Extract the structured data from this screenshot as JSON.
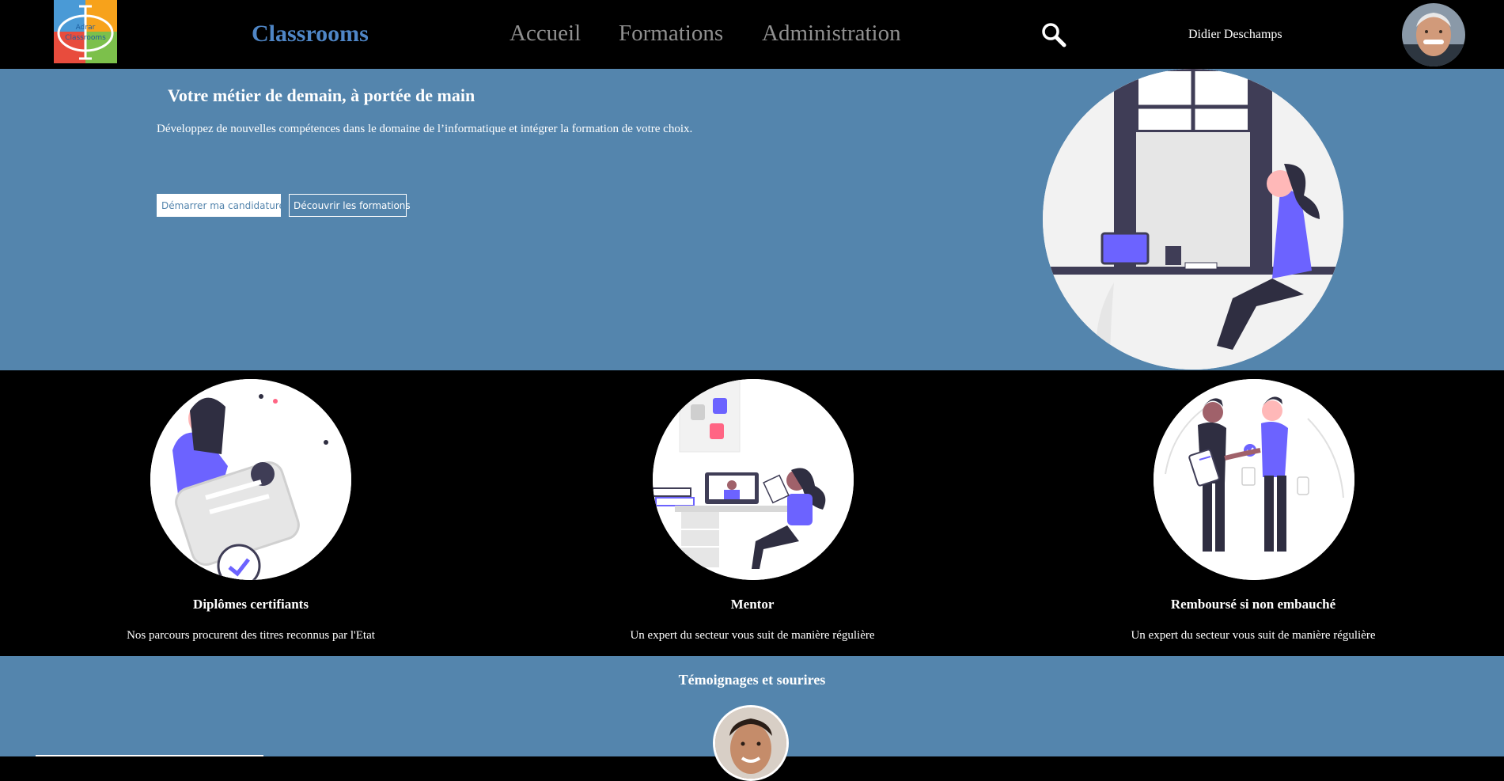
{
  "header": {
    "logo_text_top": "Adrar",
    "logo_text_bottom": "Classrooms",
    "brand": "Classrooms",
    "nav": [
      {
        "label": "Accueil"
      },
      {
        "label": "Formations"
      },
      {
        "label": "Administration"
      }
    ],
    "search_icon": "search-icon",
    "user_name": "Didier Deschamps"
  },
  "hero": {
    "title": "Votre métier de demain, à portée de main",
    "subtitle": "Développez de nouvelles compétences dans le domaine de l’informatique et intégrer la formation de votre choix.",
    "primary_button": "Démarrer ma candidature",
    "secondary_button": "Découvrir les formations"
  },
  "features": [
    {
      "title": "Diplômes certifiants",
      "description": "Nos parcours procurent des titres reconnus par l'Etat"
    },
    {
      "title": "Mentor",
      "description": "Un expert du secteur vous suit de manière régulière"
    },
    {
      "title": "Remboursé si non embauché",
      "description": "Un expert du secteur vous suit de manière régulière"
    }
  ],
  "testimonials": {
    "title": "Témoignages et sourires"
  },
  "colors": {
    "brand_blue": "#4f86c6",
    "hero_bg": "#5485ad",
    "accent_purple": "#6c63ff",
    "accent_pink": "#ff6584"
  }
}
